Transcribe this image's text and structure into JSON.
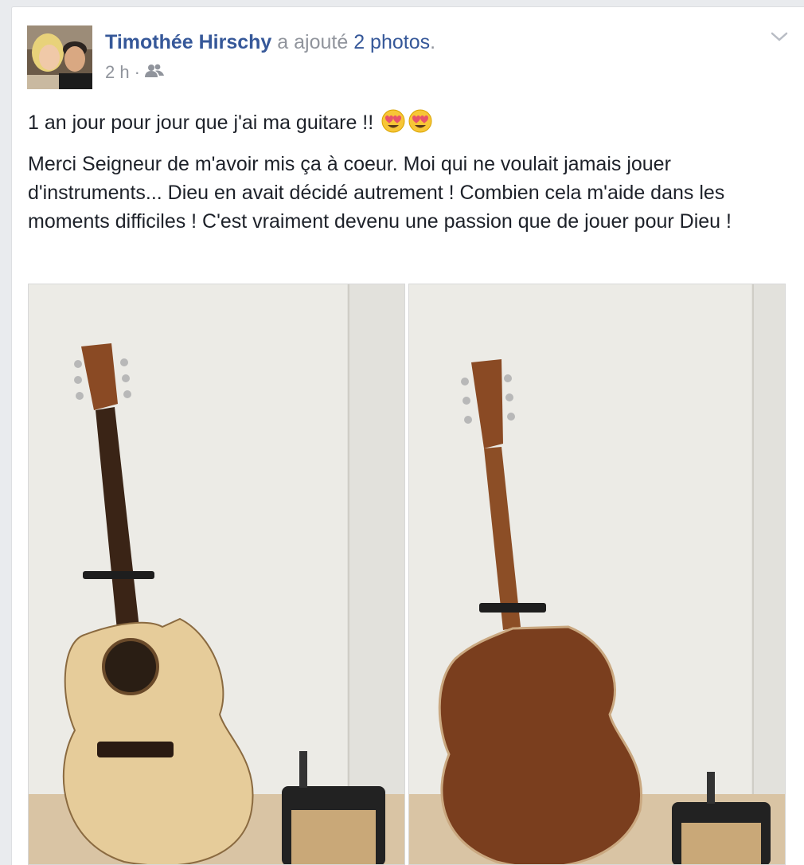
{
  "post": {
    "author": "Timothée Hirschy",
    "action_prefix": "a ajouté",
    "photos_link": "2 photos",
    "action_suffix": ".",
    "time": "2 h",
    "separator": "·",
    "audience_icon": "friends-icon",
    "menu_icon": "chevron-down-icon",
    "line1": "1 an jour pour jour que j'ai ma guitare !!",
    "emoji_icon": "heart-eyes-emoji-icon",
    "body": "Merci Seigneur de m'avoir mis ça à coeur. Moi qui ne voulait jamais jouer d'instruments... Dieu en avait décidé autrement ! Combien cela m'aide dans les moments difficiles ! C'est vraiment devenu une passion que de jouer pour Dieu !"
  },
  "photos": {
    "count": 2,
    "items": [
      "acoustic-guitar-front",
      "acoustic-guitar-back"
    ]
  },
  "colors": {
    "link": "#365899",
    "meta": "#90949c",
    "text": "#1d2129",
    "background": "#e9ebee"
  }
}
